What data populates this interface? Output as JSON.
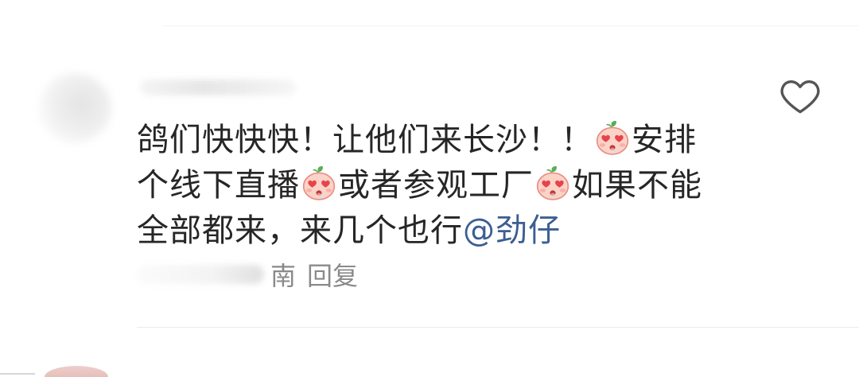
{
  "post_comment": {
    "lines": [
      [
        {
          "text": "鸽们快快快！让他们来长沙！！"
        },
        {
          "emoji": "heart-eyes-emoji"
        },
        {
          "text": "安排"
        }
      ],
      [
        {
          "text": "个线下直播"
        },
        {
          "emoji": "heart-eyes-emoji"
        },
        {
          "text": "或者参观工厂"
        },
        {
          "emoji": "heart-eyes-emoji"
        },
        {
          "text": "如果不能"
        }
      ],
      [
        {
          "text": "全部都来，来几个也行"
        },
        {
          "mention": "@劲仔"
        }
      ]
    ],
    "location": "南",
    "reply_label": "回复",
    "like_icon": "heart-outline-icon"
  },
  "colors": {
    "text": "#262626",
    "mention": "#3c5e92",
    "meta": "#8a8a8a",
    "divider": "#ececec",
    "like_icon": "#555555"
  }
}
